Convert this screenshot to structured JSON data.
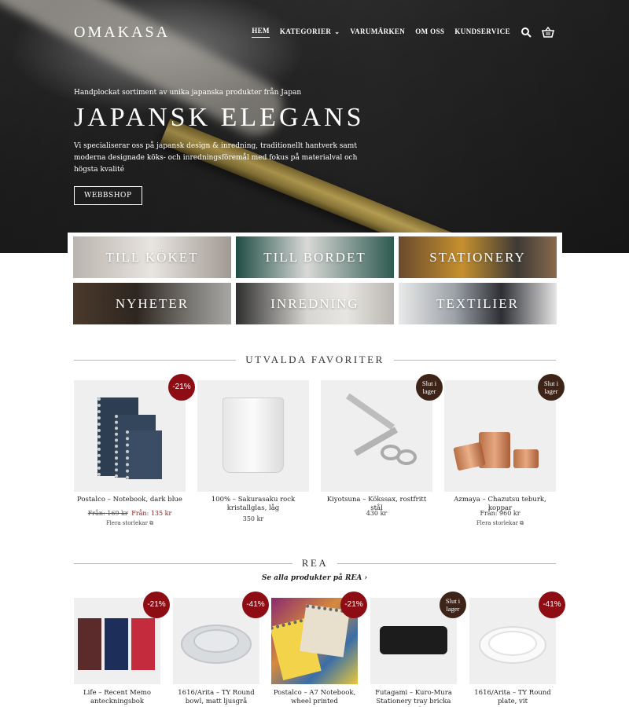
{
  "header": {
    "logo": "OMAKASA",
    "nav": [
      {
        "label": "HEM",
        "active": true
      },
      {
        "label": "KATEGORIER",
        "has_dropdown": true
      },
      {
        "label": "VARUMÄRKEN"
      },
      {
        "label": "OM OSS"
      },
      {
        "label": "KUNDSERVICE"
      }
    ],
    "icons": [
      "search-icon",
      "basket-icon"
    ]
  },
  "hero": {
    "kicker": "Handplockat sortiment av unika japanska produkter från Japan",
    "title": "JAPANSK ELEGANS",
    "description": "Vi specialiserar oss på japansk design & inredning, traditionellt hantverk samt moderna designade köks- och inredningsföremål med fokus på materialval och högsta kvalité",
    "button": "WEBBSHOP"
  },
  "categories": [
    "TILL KÖKET",
    "TILL BORDET",
    "STATIONERY",
    "NYHETER",
    "INREDNING",
    "TEXTILIER"
  ],
  "favorites": {
    "title": "UTVALDA FAVORITER",
    "products": [
      {
        "name": "Postalco – Notebook, dark blue",
        "old_price": "169 kr",
        "price_prefix": "Från:",
        "price": "135 kr",
        "old_prefix": "Från:",
        "sizes": "Flera storlekar",
        "badge": "-21%"
      },
      {
        "name": "100% – Sakurasaku rock kristallglas, låg",
        "price": "350 kr"
      },
      {
        "name": "Kiyotsuna – Kökssax, rostfritt stål",
        "price": "430 kr",
        "badge": "Slut i lager"
      },
      {
        "name": "Azmaya – Chazutsu teburk, koppar",
        "price_prefix": "Från:",
        "price": "960 kr",
        "sizes": "Flera storlekar",
        "badge": "Slut i lager"
      }
    ]
  },
  "sale": {
    "title": "REA",
    "see_all": "Se alla produkter på REA ›",
    "products": [
      {
        "name": "Life – Recent Memo anteckningsbok",
        "badge": "-21%"
      },
      {
        "name": "1616/Arita – TY Round bowl, matt ljusgrå",
        "badge": "-41%"
      },
      {
        "name": "Postalco – A7 Notebook, wheel printed",
        "badge": "-21%"
      },
      {
        "name": "Futagami – Kuro-Mura Stationery tray bricka Large, mässing",
        "badge": "Slut i lager"
      },
      {
        "name": "1616/Arita – TY Round plate, vit",
        "badge": "-41%"
      }
    ]
  },
  "colors": {
    "sale_badge": "#8e0d14",
    "soldout_badge": "#3e2418",
    "sale_price": "#8a1a1a"
  }
}
